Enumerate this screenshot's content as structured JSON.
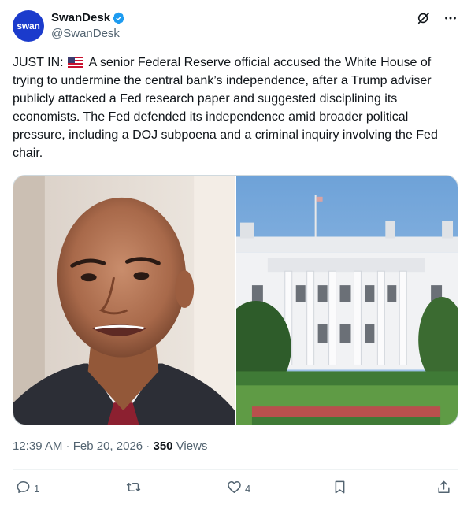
{
  "account": {
    "avatar_text": "swan",
    "display_name": "SwanDesk",
    "handle": "@SwanDesk",
    "verified": true
  },
  "icons": {
    "verified": "verified-badge-icon",
    "grok": "grok-icon",
    "more": "more-icon",
    "flag": "us-flag-emoji",
    "reply": "reply-icon",
    "retweet": "retweet-icon",
    "like": "heart-icon",
    "bookmark": "bookmark-icon",
    "share": "share-icon"
  },
  "tweet": {
    "prefix": "JUST IN: ",
    "body": " A senior Federal Reserve official accused the White House of trying to undermine the central bank’s independence, after a Trump adviser publicly attacked a Fed research paper and suggested disciplining its economists. The Fed defended its independence amid broader political pressure, including a DOJ subpoena and a criminal inquiry involving the Fed chair."
  },
  "media": [
    {
      "subject": "portrait-photo"
    },
    {
      "subject": "white-house-photo"
    }
  ],
  "meta": {
    "time": "12:39 AM",
    "separator": " · ",
    "date": "Feb 20, 2026",
    "views_count": "350",
    "views_label": " Views"
  },
  "actions": {
    "replies": "1",
    "reposts": "",
    "likes": "4"
  },
  "colors": {
    "avatar_bg": "#1b3bcc",
    "verified": "#1d9bf0",
    "text": "#0f1419",
    "secondary": "#536471",
    "border": "#cfd9de"
  }
}
